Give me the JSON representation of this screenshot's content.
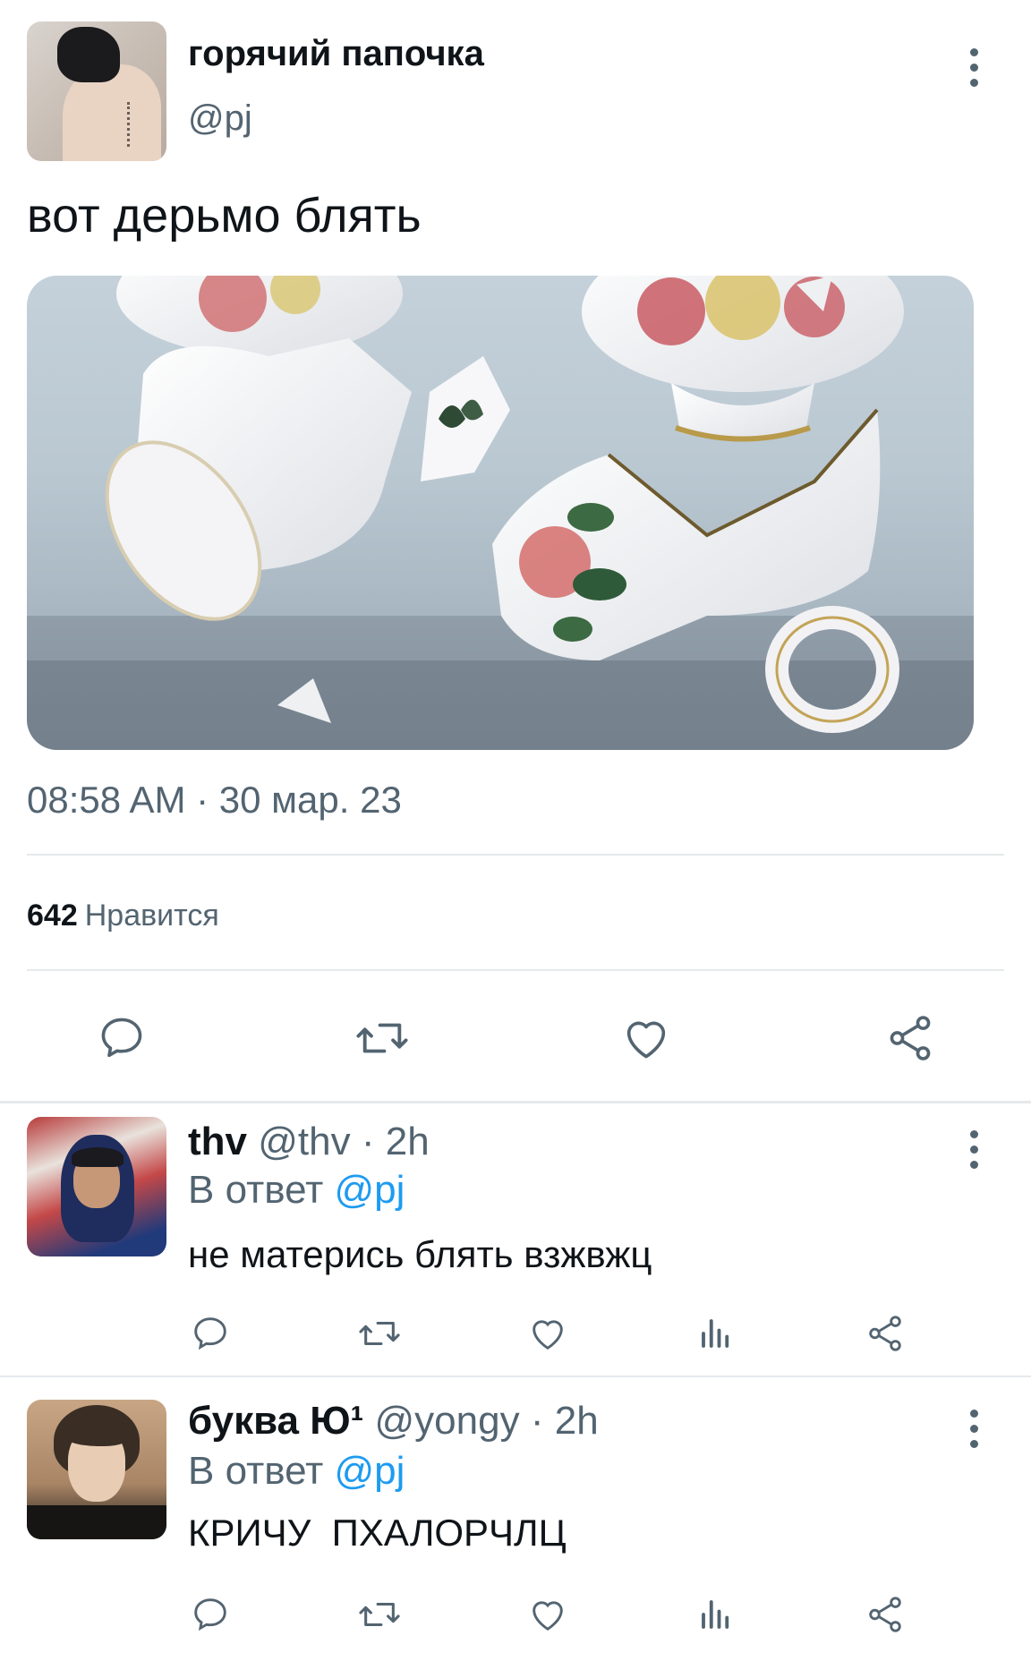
{
  "tweet": {
    "display_name": "горячий папочка",
    "handle": "@pj",
    "text": "вот дерьмо блять",
    "timestamp": "08:58 AM · 30 мар. 23",
    "likes_count": "642",
    "likes_label": "Нравится",
    "icons": [
      "reply-icon",
      "retweet-icon",
      "like-icon",
      "share-icon"
    ]
  },
  "replies": [
    {
      "display_name": "thv",
      "handle": "@thv",
      "sep": "·",
      "time": "2h",
      "in_reply_prefix": "В ответ",
      "in_reply_mention": "@pj",
      "text": "не матерись блять взжвжц"
    },
    {
      "display_name": "буква Ю¹",
      "handle": "@yongy",
      "sep": "·",
      "time": "2h",
      "in_reply_prefix": "В ответ",
      "in_reply_mention": "@pj",
      "text": "КРИЧУ  ПХАЛОРЧЛЦ"
    }
  ],
  "colors": {
    "text": "#0f1419",
    "secondary": "#536471",
    "accent": "#1d9bf0",
    "divider": "#e6e9ec"
  }
}
